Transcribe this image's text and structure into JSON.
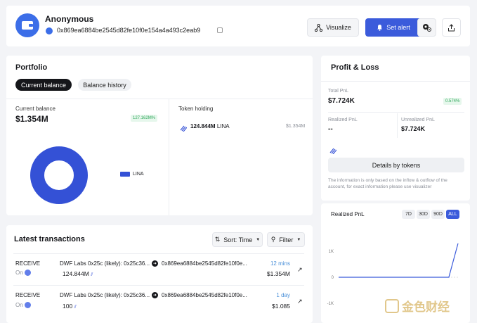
{
  "header": {
    "name": "Anonymous",
    "address": "0x869ea6884be2545d82fe10f0e154a4a493c2eab9",
    "visualize_label": "Visualize",
    "set_alert_label": "Set alert"
  },
  "portfolio": {
    "title": "Portfolio",
    "tabs": [
      "Current balance",
      "Balance history"
    ],
    "current_balance_label": "Current balance",
    "current_balance_value": "$1.354M",
    "balance_change": "127.162M%",
    "legend_label": "LINA",
    "token_holding_label": "Token holding",
    "holding_amount": "124.844M",
    "holding_symbol": "LINA",
    "holding_value": "$1.354M",
    "donut_share": 1.0
  },
  "pnl": {
    "title": "Profit & Loss",
    "total_label": "Total PnL",
    "total_value": "$7.724K",
    "total_change": "0.574%",
    "realized_label": "Realized PnL",
    "realized_value": "--",
    "unrealized_label": "Unrealized PnL",
    "unrealized_value": "$7.724K",
    "details_label": "Details by tokens",
    "note": "The information is only based on the inflow & outflow of the account, for exact information please use visualizer"
  },
  "realized_chart": {
    "title": "Realized PnL",
    "ranges": [
      "7D",
      "30D",
      "90D",
      "ALL"
    ],
    "selected_range": "ALL",
    "y_ticks": [
      "1K",
      "0",
      "-1K"
    ]
  },
  "chart_data": {
    "type": "line",
    "title": "Realized PnL",
    "xlabel": "",
    "ylabel": "",
    "ylim": [
      -1000,
      1000
    ],
    "x": [
      0,
      1,
      2,
      3,
      4,
      5,
      6,
      7,
      8,
      9,
      10,
      11,
      12,
      13
    ],
    "values": [
      0,
      0,
      0,
      0,
      0,
      0,
      0,
      0,
      0,
      0,
      0,
      0,
      0,
      1300
    ],
    "grid": false,
    "legend": "none"
  },
  "transactions": {
    "title": "Latest transactions",
    "sort_label": "Sort: Time",
    "filter_label": "Filter",
    "rows": [
      {
        "type": "RECEIVE",
        "on_label": "On",
        "from": "DWF Labs 0x25c (likely): 0x25c36...",
        "to": "0x869ea6884be2545d82fe10f0e...",
        "amount": "124.844M",
        "time": "12 mins",
        "value": "$1.354M"
      },
      {
        "type": "RECEIVE",
        "on_label": "On",
        "from": "DWF Labs 0x25c (likely): 0x25c36...",
        "to": "0x869ea6884be2545d82fe10f0e...",
        "amount": "100",
        "time": "1 day",
        "value": "$1.085"
      }
    ]
  },
  "watermark": "金色财经",
  "colors": {
    "accent": "#3b5bdb",
    "donut": "#3451d6",
    "positive_bg": "#e6f7ec",
    "positive_text": "#2fa75a",
    "time_blue": "#4a90d9"
  }
}
